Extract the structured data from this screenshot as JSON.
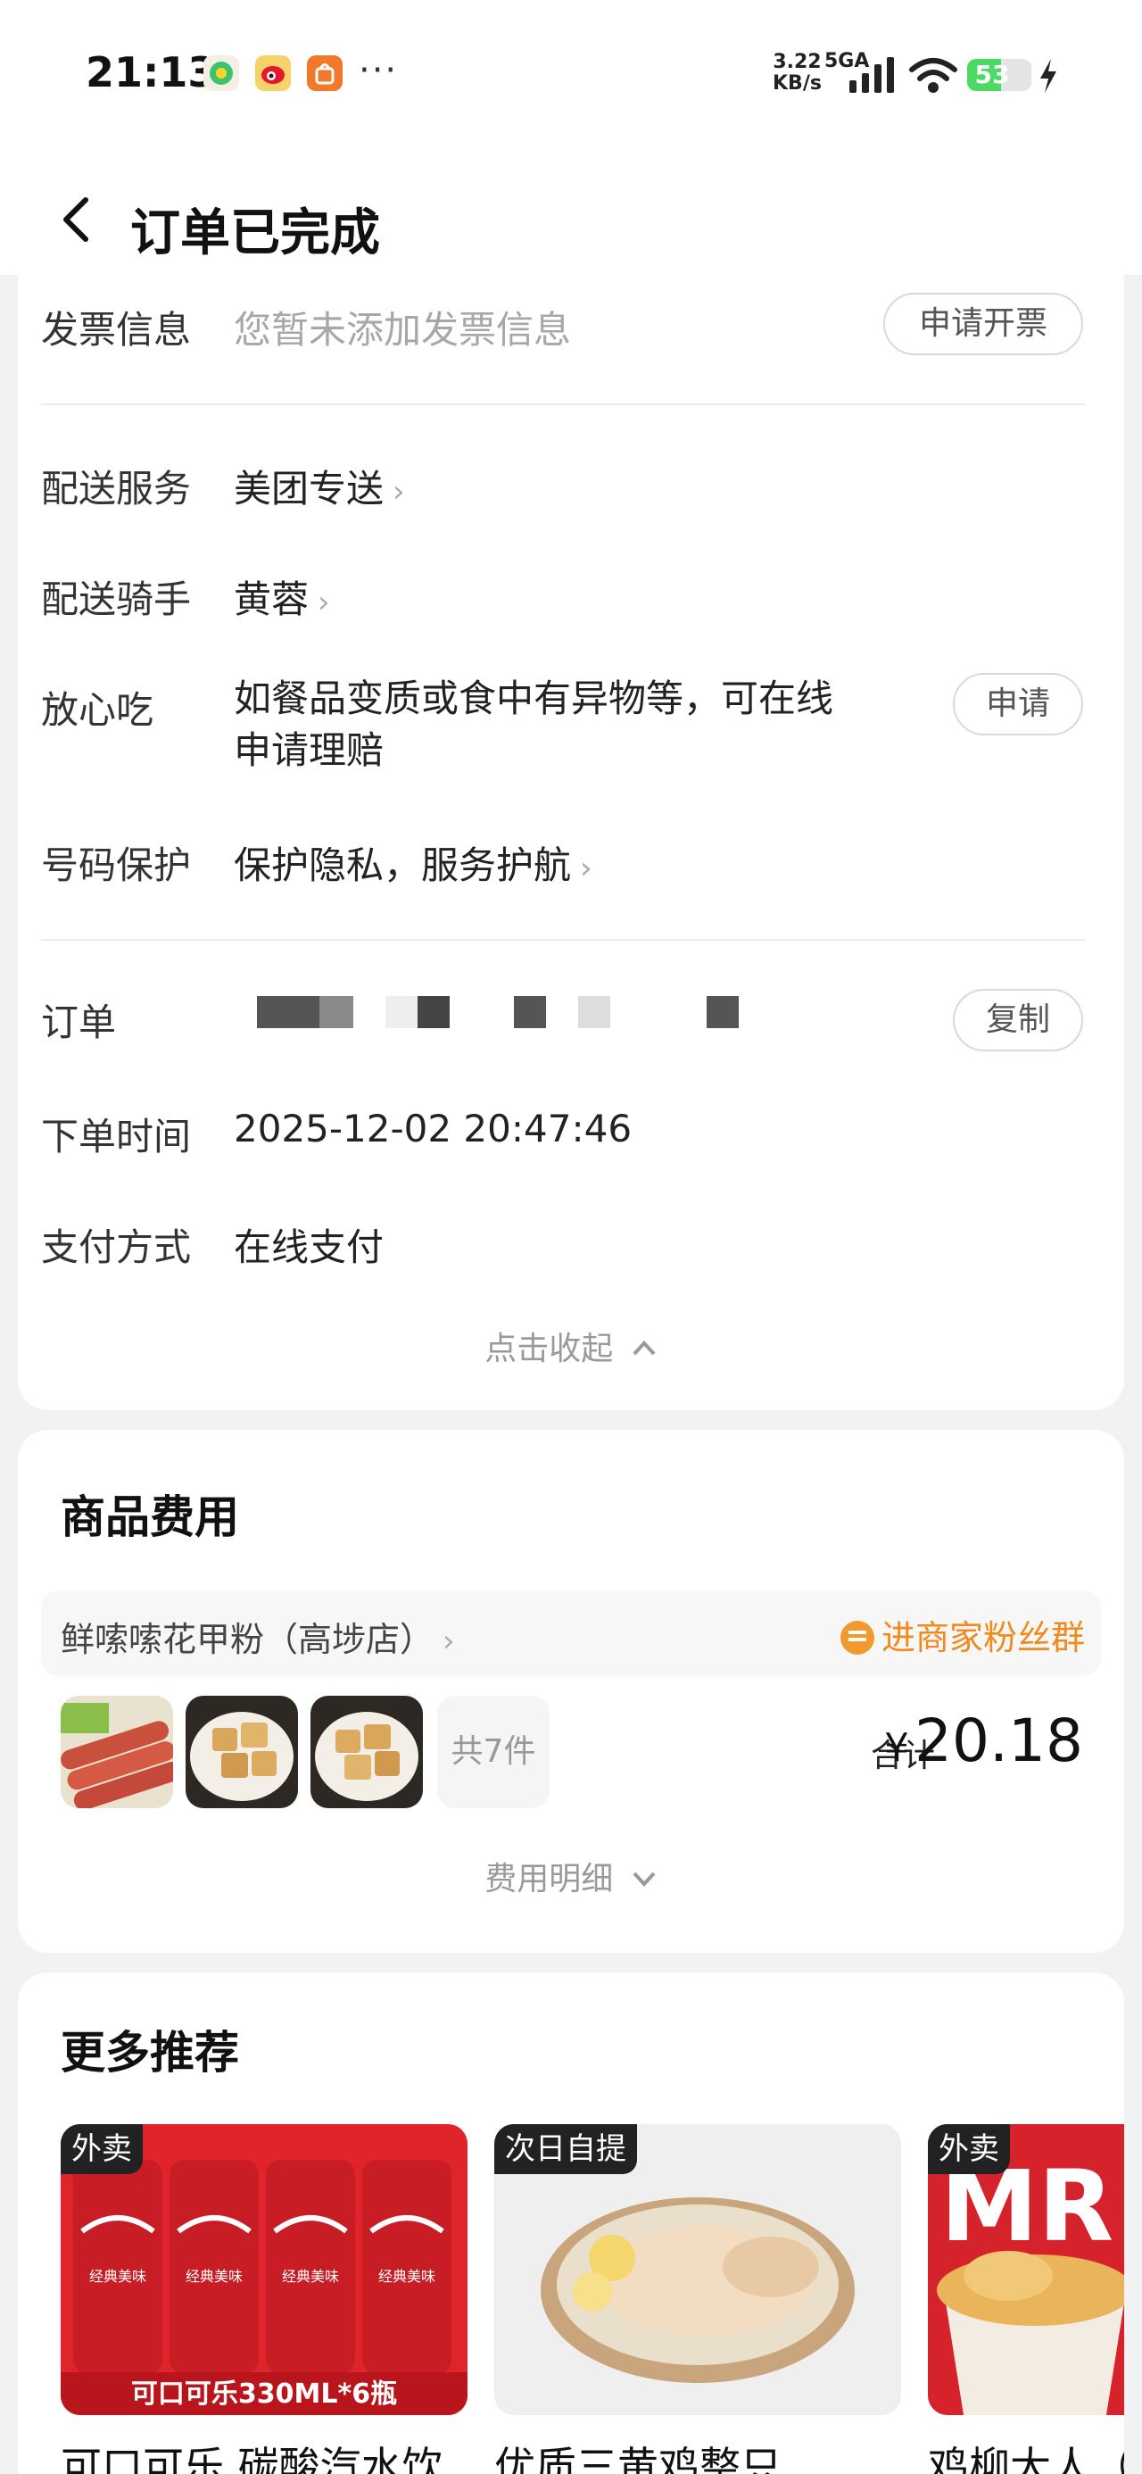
{
  "status_bar": {
    "time": "21:13",
    "net_speed_value": "3.22",
    "net_speed_unit": "KB/s",
    "network": "5GA",
    "battery": "53",
    "battery_level": 0.53
  },
  "header": {
    "title": "订单已完成"
  },
  "order_info": {
    "invoice_label": "发票信息",
    "invoice_value": "您暂未添加发票信息",
    "invoice_button": "申请开票",
    "delivery_service_label": "配送服务",
    "delivery_service_value": "美团专送",
    "rider_label": "配送骑手",
    "rider_value": "黄蓉",
    "safe_eat_label": "放心吃",
    "safe_eat_value_line1": "如餐品变质或食中有异物等，可在线",
    "safe_eat_value_line2": "申请理赔",
    "safe_eat_button": "申请",
    "number_protect_label": "号码保护",
    "number_protect_value": "保护隐私，服务护航",
    "order_no_label": "订单",
    "copy_button": "复制",
    "order_time_label": "下单时间",
    "order_time_value": "2025-12-02 20:47:46",
    "payment_label": "支付方式",
    "payment_value": "在线支付",
    "collapse_link": "点击收起"
  },
  "goods": {
    "title": "商品费用",
    "store_name": "鲜嗦嗦花甲粉（高埗店）",
    "fan_group": "进商家粉丝群",
    "item_count": "共7件",
    "total_label": "合计",
    "currency": "¥",
    "total_amount": "20.18",
    "details_link": "费用明细"
  },
  "recommend": {
    "title": "更多推荐",
    "items": [
      {
        "tag": "外卖",
        "name": "可口可乐 碳酸汽水饮",
        "banner": "可口可乐330ML*6瓶",
        "can_text": "经典美味"
      },
      {
        "tag": "次日自提",
        "name": "优质三黄鸡整只"
      },
      {
        "tag": "外卖",
        "name": "鸡柳大人（",
        "logo": "MR"
      }
    ]
  },
  "colors": {
    "accent_orange": "#f08a1c",
    "battery_green": "#4cd964",
    "coke_red": "#d8232a"
  }
}
